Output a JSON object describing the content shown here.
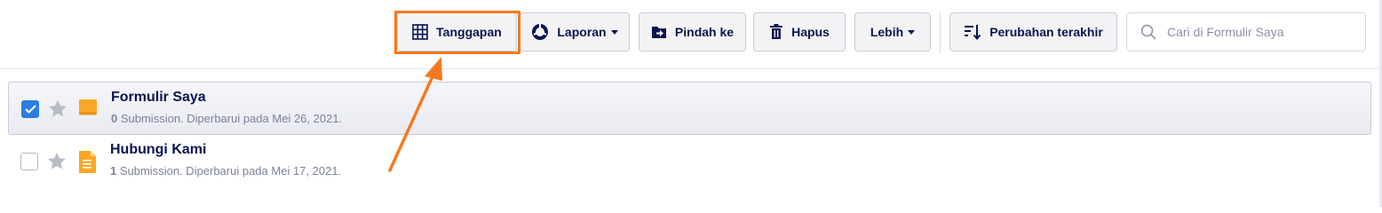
{
  "toolbar": {
    "responses_label": "Tanggapan",
    "reports_label": "Laporan",
    "move_label": "Pindah ke",
    "delete_label": "Hapus",
    "more_label": "Lebih",
    "sort_label": "Perubahan terakhir"
  },
  "search": {
    "placeholder": "Cari di Formulir Saya"
  },
  "forms": [
    {
      "title": "Formulir Saya",
      "count": "0",
      "meta": " Submission. Diperbarui pada Mei 26, 2021.",
      "selected": true,
      "starred": false,
      "icon": "folder-form-icon"
    },
    {
      "title": "Hubungi Kami",
      "count": "1",
      "meta": " Submission. Diperbarui pada Mei 17, 2021.",
      "selected": false,
      "starred": false,
      "icon": "document-form-icon"
    }
  ],
  "colors": {
    "highlight": "#f47a1f",
    "accent": "#2c7de0",
    "form_icon": "#f9a825",
    "text": "#0a1551"
  }
}
